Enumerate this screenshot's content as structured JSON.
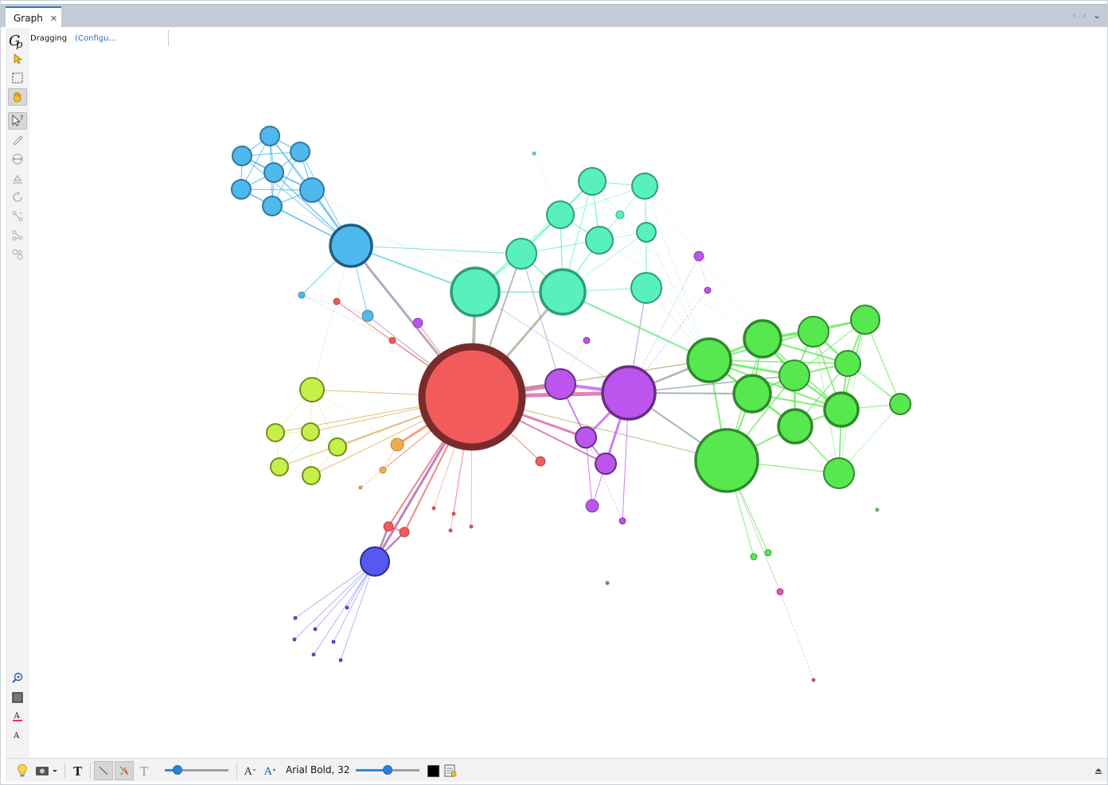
{
  "tab": {
    "title": "Graph",
    "close_glyph": "✕"
  },
  "tab_nav": {
    "prev": "‹",
    "next": "›",
    "menu": "⌄"
  },
  "header": {
    "tool_name": "Dragging",
    "configure_link": "(Configu..."
  },
  "left_toolbar": [
    {
      "name": "gephi-logo-icon"
    },
    {
      "name": "pointer-select-icon"
    },
    {
      "name": "rectangle-select-icon"
    },
    {
      "name": "drag-hand-icon",
      "active": true
    },
    {
      "name": "edit-pointer-icon",
      "active": true
    },
    {
      "name": "painter-icon"
    },
    {
      "name": "shortest-path-icon"
    },
    {
      "name": "size-icon"
    },
    {
      "name": "heat-map-icon"
    },
    {
      "name": "edge-pencil-icon"
    },
    {
      "name": "node-pencil-icon"
    },
    {
      "name": "brush-icon"
    }
  ],
  "left_toolbar_bottom": [
    {
      "name": "zoom-fit-icon"
    },
    {
      "name": "background-color-icon"
    },
    {
      "name": "font-color-icon"
    },
    {
      "name": "font-size-icon"
    }
  ],
  "bottom_bar": {
    "font_label": "Arial Bold, 32",
    "edge_thickness_slider": 0.2,
    "font_size_slider": 0.5,
    "text_color": "#000000",
    "items": [
      "light-bulb-icon",
      "screenshot-icon",
      "show-labels-icon",
      "edge-select-icon",
      "edge-color-icon",
      "label-size-icon",
      "font-decrease-icon",
      "font-icon",
      "text-color-swatch",
      "label-settings-icon",
      "collapse-panel-icon"
    ]
  },
  "graph": {
    "nodes": [
      {
        "id": "n1",
        "color": "#4fb8ec",
        "stroke": "#2e7ba0"
      },
      {
        "id": "n2",
        "color": "#4fb8ec",
        "stroke": "#2e7ba0"
      },
      {
        "id": "n3",
        "color": "#4fb8ec",
        "stroke": "#2e7ba0"
      },
      {
        "id": "n4",
        "color": "#4fb8ec",
        "stroke": "#2e7ba0"
      },
      {
        "id": "n5",
        "color": "#4fb8ec",
        "stroke": "#2e7ba0"
      },
      {
        "id": "n6",
        "color": "#4fb8ec",
        "stroke": "#2e7ba0"
      },
      {
        "id": "n7",
        "color": "#4fb8ec",
        "stroke": "#2e7ba0"
      },
      {
        "id": "n8",
        "color": "#4fb8ec",
        "stroke": "#1f5e80"
      },
      {
        "id": "n9",
        "color": "#4fb8ec",
        "stroke": "#2e7ba0"
      },
      {
        "id": "n10",
        "color": "#4fb8ec",
        "stroke": "#2e7ba0"
      },
      {
        "id": "t1",
        "color": "#58f0bd",
        "stroke": "#2f9e77"
      },
      {
        "id": "t2",
        "color": "#58f0bd",
        "stroke": "#2f9e77"
      },
      {
        "id": "t3",
        "color": "#58f0bd",
        "stroke": "#2f9e77"
      },
      {
        "id": "t4",
        "color": "#58f0bd",
        "stroke": "#2f9e77"
      },
      {
        "id": "t5",
        "color": "#58f0bd",
        "stroke": "#2f9e77"
      },
      {
        "id": "t6",
        "color": "#58f0bd",
        "stroke": "#2f9e77"
      },
      {
        "id": "t7",
        "color": "#58f0bd",
        "stroke": "#2f9e77"
      },
      {
        "id": "t8",
        "color": "#58f0bd",
        "stroke": "#2f9e77"
      },
      {
        "id": "t9",
        "color": "#58f0bd",
        "stroke": "#2f9e77"
      },
      {
        "id": "t10",
        "color": "#58f0bd",
        "stroke": "#2f9e77"
      },
      {
        "id": "t11",
        "color": "#58f0bd",
        "stroke": "#2f9e77"
      },
      {
        "id": "g1",
        "color": "#57e84f",
        "stroke": "#2f8a2b"
      },
      {
        "id": "g2",
        "color": "#57e84f",
        "stroke": "#2f8a2b"
      },
      {
        "id": "g3",
        "color": "#57e84f",
        "stroke": "#2f8a2b"
      },
      {
        "id": "g4",
        "color": "#57e84f",
        "stroke": "#2f8a2b"
      },
      {
        "id": "g5",
        "color": "#57e84f",
        "stroke": "#2f8a2b"
      },
      {
        "id": "g6",
        "color": "#57e84f",
        "stroke": "#2f8a2b"
      },
      {
        "id": "g7",
        "color": "#57e84f",
        "stroke": "#2f8a2b"
      },
      {
        "id": "g8",
        "color": "#57e84f",
        "stroke": "#2f8a2b"
      },
      {
        "id": "g9",
        "color": "#57e84f",
        "stroke": "#2f8a2b"
      },
      {
        "id": "g10",
        "color": "#57e84f",
        "stroke": "#2f8a2b"
      },
      {
        "id": "g11",
        "color": "#57e84f",
        "stroke": "#2f8a2b"
      },
      {
        "id": "g12",
        "color": "#57e84f",
        "stroke": "#2f8a2b"
      },
      {
        "id": "g13",
        "color": "#57e84f",
        "stroke": "#2f8a2b"
      },
      {
        "id": "g14",
        "color": "#57e84f",
        "stroke": "#2f8a2b"
      },
      {
        "id": "r1",
        "color": "#f25b5b",
        "stroke": "#7a2a2a"
      },
      {
        "id": "r2",
        "color": "#f25b5b",
        "stroke": "#a33"
      },
      {
        "id": "r3",
        "color": "#f25b5b",
        "stroke": "#a33"
      },
      {
        "id": "r4",
        "color": "#f25b5b",
        "stroke": "#a33"
      },
      {
        "id": "r5",
        "color": "#f25b5b",
        "stroke": "#a33"
      },
      {
        "id": "r6",
        "color": "#f25b5b",
        "stroke": "#a33"
      },
      {
        "id": "r7",
        "color": "#f25b5b",
        "stroke": "#a33"
      },
      {
        "id": "r8",
        "color": "#f25b5b",
        "stroke": "#a33"
      },
      {
        "id": "r9",
        "color": "#f25b5b",
        "stroke": "#a33"
      },
      {
        "id": "r10",
        "color": "#f25b5b",
        "stroke": "#a33"
      },
      {
        "id": "p1",
        "color": "#bb55ee",
        "stroke": "#6a2d80"
      },
      {
        "id": "p2",
        "color": "#bb55ee",
        "stroke": "#6a2d80"
      },
      {
        "id": "p3",
        "color": "#bb55ee",
        "stroke": "#6a2d80"
      },
      {
        "id": "p4",
        "color": "#bb55ee",
        "stroke": "#6a2d80"
      },
      {
        "id": "p5",
        "color": "#bb55ee",
        "stroke": "#6a2d80"
      },
      {
        "id": "p6",
        "color": "#bb55ee",
        "stroke": "#6a2d80"
      },
      {
        "id": "p7",
        "color": "#bb55ee",
        "stroke": "#6a2d80"
      },
      {
        "id": "p8",
        "color": "#bb55ee",
        "stroke": "#6a2d80"
      },
      {
        "id": "p9",
        "color": "#bb55ee",
        "stroke": "#6a2d80"
      },
      {
        "id": "p10",
        "color": "#bb55ee",
        "stroke": "#6a2d80"
      },
      {
        "id": "y1",
        "color": "#c6ef4a",
        "stroke": "#6f8f22"
      },
      {
        "id": "y2",
        "color": "#c6ef4a",
        "stroke": "#6f8f22"
      },
      {
        "id": "y3",
        "color": "#c6ef4a",
        "stroke": "#6f8f22"
      },
      {
        "id": "y4",
        "color": "#c6ef4a",
        "stroke": "#6f8f22"
      },
      {
        "id": "y5",
        "color": "#c6ef4a",
        "stroke": "#6f8f22"
      },
      {
        "id": "y6",
        "color": "#c6ef4a",
        "stroke": "#6f8f22"
      },
      {
        "id": "o1",
        "color": "#f2ad4b",
        "stroke": "#b0782a"
      },
      {
        "id": "o2",
        "color": "#f2ad4b",
        "stroke": "#b0782a"
      },
      {
        "id": "o3",
        "color": "#f2ad4b",
        "stroke": "#b0782a"
      },
      {
        "id": "b1",
        "color": "#5758ef",
        "stroke": "#2a2b8a"
      },
      {
        "id": "b2",
        "color": "#5758ef",
        "stroke": "#2a2b8a"
      },
      {
        "id": "b3",
        "color": "#5758ef",
        "stroke": "#2a2b8a"
      },
      {
        "id": "b4",
        "color": "#5758ef",
        "stroke": "#2a2b8a"
      },
      {
        "id": "b5",
        "color": "#5758ef",
        "stroke": "#2a2b8a"
      },
      {
        "id": "b6",
        "color": "#5758ef",
        "stroke": "#2a2b8a"
      },
      {
        "id": "b7",
        "color": "#5758ef",
        "stroke": "#2a2b8a"
      },
      {
        "id": "b8",
        "color": "#5758ef",
        "stroke": "#2a2b8a"
      },
      {
        "id": "m1",
        "color": "#e94fb3",
        "stroke": "#94306f"
      },
      {
        "id": "m2",
        "color": "#e94fb3",
        "stroke": "#94306f"
      }
    ]
  }
}
